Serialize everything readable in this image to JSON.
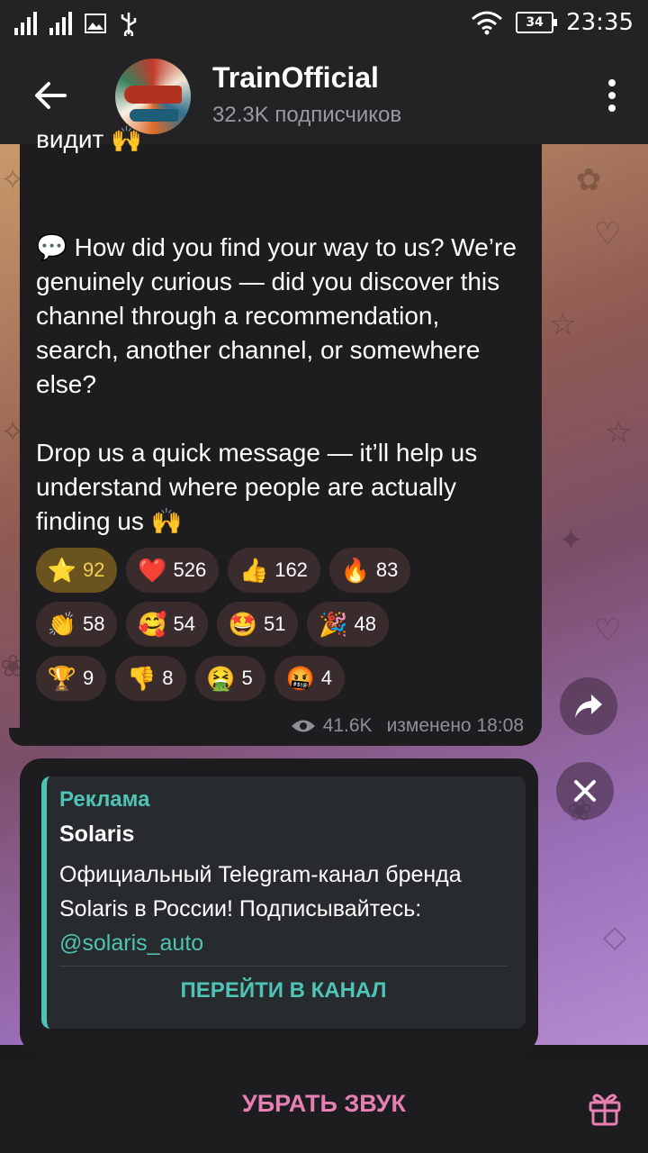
{
  "status_bar": {
    "time": "23:35",
    "battery": "34"
  },
  "header": {
    "channel_name": "TrainOfficial",
    "subscribers": "32.3K подписчиков"
  },
  "message": {
    "cut_line": "видит 🙌",
    "text": "💬 How did you find your way to us? We’re genuinely curious — did you discover this channel through a recommendation, search, another channel, or somewhere else?\n\nDrop us a quick message — it’ll help us understand where people are actually finding us 🙌",
    "views": "41.6K",
    "edited": "изменено 18:08",
    "reactions": [
      [
        {
          "emoji": "⭐",
          "count": "92",
          "active": true
        },
        {
          "emoji": "❤️",
          "count": "526"
        },
        {
          "emoji": "👍",
          "count": "162"
        },
        {
          "emoji": "🔥",
          "count": "83"
        }
      ],
      [
        {
          "emoji": "👏",
          "count": "58"
        },
        {
          "emoji": "🥰",
          "count": "54"
        },
        {
          "emoji": "🤩",
          "count": "51"
        },
        {
          "emoji": "🎉",
          "count": "48"
        }
      ],
      [
        {
          "emoji": "🏆",
          "count": "9"
        },
        {
          "emoji": "👎",
          "count": "8"
        },
        {
          "emoji": "🤮",
          "count": "5"
        },
        {
          "emoji": "🤬",
          "count": "4"
        }
      ]
    ]
  },
  "ad": {
    "label": "Реклама",
    "title": "Solaris",
    "body": "Официальный Telegram-канал бренда Solaris в России! Подписывайтесь: ",
    "link": "@solaris_auto",
    "button": "ПЕРЕЙТИ В КАНАЛ"
  },
  "bottom": {
    "mute_label": "УБРАТЬ ЗВУК"
  },
  "colors": {
    "accent": "#4fc3b5",
    "mute": "#e77fb3",
    "active_reaction": "#6b5320"
  }
}
